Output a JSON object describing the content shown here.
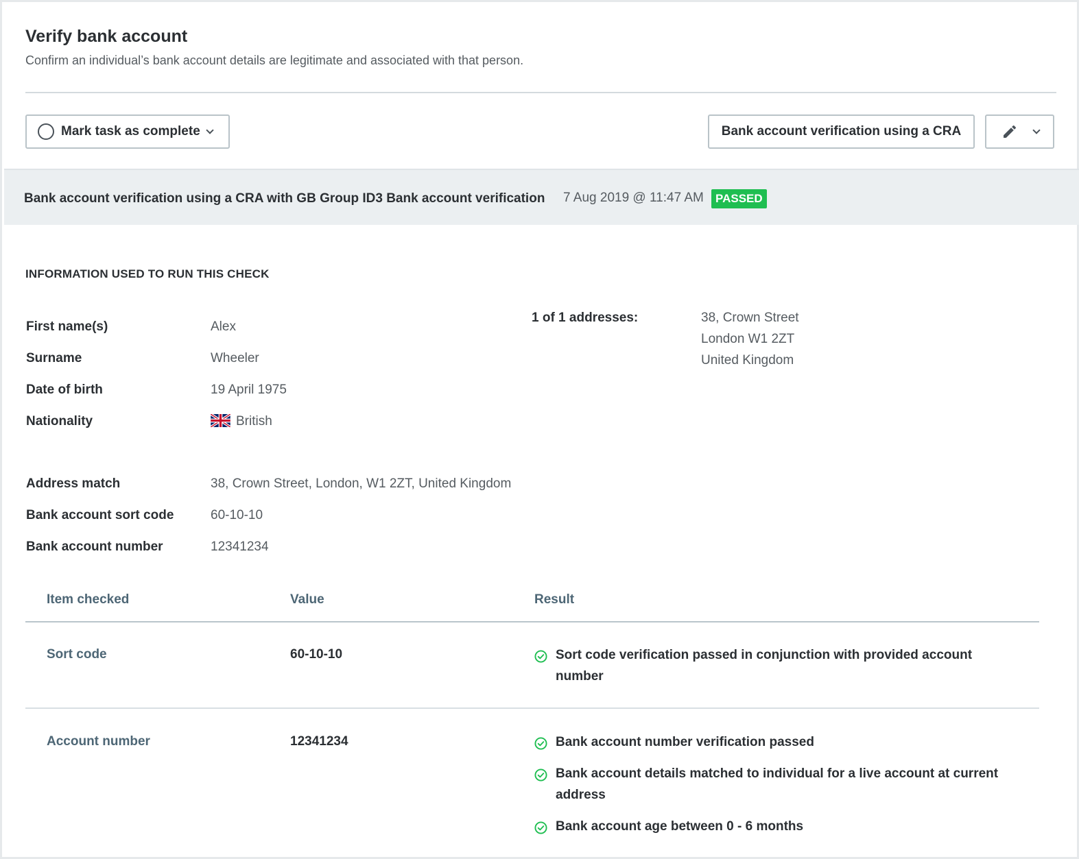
{
  "header": {
    "title": "Verify bank account",
    "subtitle": "Confirm an individual’s bank account details are legitimate and associated with that person."
  },
  "toolbar": {
    "complete_label": "Mark task as complete",
    "check_type_label": "Bank account verification using a CRA"
  },
  "banner": {
    "title": "Bank account verification using a CRA with GB Group ID3 Bank account verification",
    "date": "7 Aug 2019 @ 11:47 AM",
    "status": "PASSED"
  },
  "info": {
    "heading": "INFORMATION USED TO RUN THIS CHECK",
    "first_name_label": "First name(s)",
    "first_name": "Alex",
    "surname_label": "Surname",
    "surname": "Wheeler",
    "dob_label": "Date of birth",
    "dob": "19 April 1975",
    "nationality_label": "Nationality",
    "nationality": "British",
    "address_match_label": "Address match",
    "address_match": "38, Crown Street, London, W1 2ZT, United Kingdom",
    "sort_code_label": "Bank account sort code",
    "sort_code": "60-10-10",
    "account_number_label": "Bank account number",
    "account_number": "12341234",
    "addresses_label": "1 of 1 addresses:",
    "address_lines": [
      "38, Crown Street",
      "London W1 2ZT",
      "United Kingdom"
    ]
  },
  "table": {
    "headers": [
      "Item checked",
      "Value",
      "Result"
    ],
    "rows": [
      {
        "item": "Sort code",
        "value": "60-10-10",
        "results": [
          "Sort code verification passed in conjunction with provided account number"
        ]
      },
      {
        "item": "Account number",
        "value": "12341234",
        "results": [
          "Bank account number verification passed",
          "Bank account details matched to individual for a live account at current address",
          "Bank account age between 0 - 6 months"
        ]
      }
    ]
  },
  "colors": {
    "passed": "#1fbe51",
    "banner_bg": "#ebeff1",
    "table_header": "#4d6675"
  },
  "icons": [
    "circle-icon",
    "chevron-down-icon",
    "pencil-icon",
    "uk-flag-icon",
    "check-circle-icon"
  ]
}
